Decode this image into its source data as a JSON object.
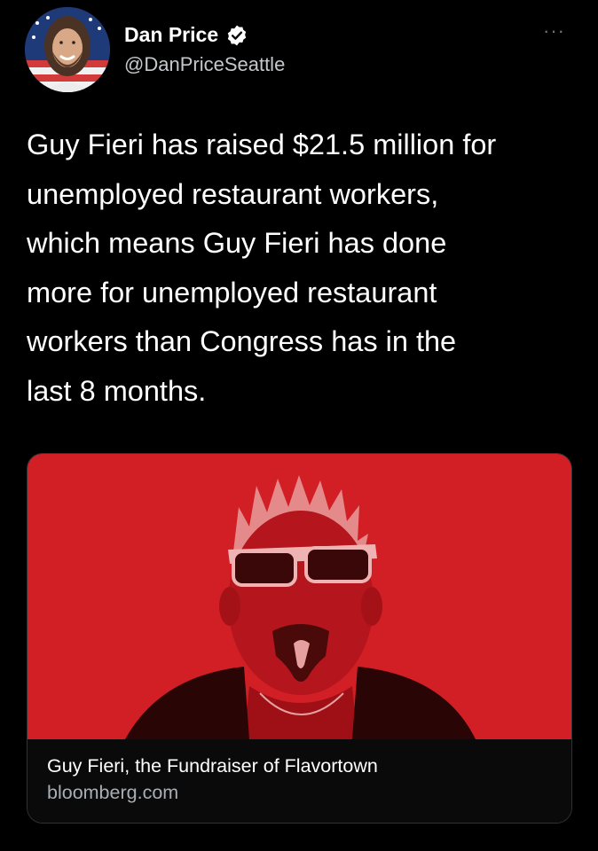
{
  "author": {
    "display_name": "Dan Price",
    "handle": "@DanPriceSeattle",
    "verified": true,
    "avatar_icon": "profile-photo-icon"
  },
  "menu": {
    "more_label": "···"
  },
  "tweet": {
    "lines": [
      "Guy Fieri has raised $21.5 million for",
      "unemployed restaurant workers,",
      "which means Guy Fieri has done",
      "more for unemployed restaurant",
      "workers than Congress has in the",
      "last 8 months."
    ]
  },
  "link_card": {
    "title": "Guy Fieri, the Fundraiser of Flavortown",
    "domain": "bloomberg.com",
    "image_icon": "portrait-photo-icon"
  },
  "colors": {
    "background": "#000000",
    "card_image_red": "#d21f26",
    "verified_badge": "#ffffff",
    "secondary_text": "#a9aeb3"
  }
}
